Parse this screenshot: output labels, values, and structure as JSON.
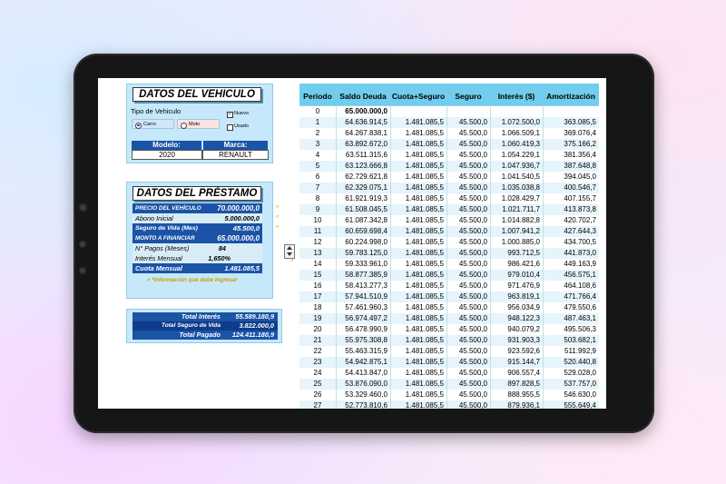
{
  "vehicle": {
    "title": "DATOS DEL VEHICULO",
    "type_label": "Tipo de Vehiculo",
    "options": [
      {
        "label": "Carro",
        "selected": true
      },
      {
        "label": "Moto",
        "selected": false
      }
    ],
    "condition": [
      {
        "label": "Nuevo",
        "checked": true
      },
      {
        "label": "Usado",
        "checked": false
      }
    ],
    "model_header": "Modelo:",
    "brand_header": "Marca:",
    "model_value": "2020",
    "brand_value": "RENAULT"
  },
  "loan": {
    "title": "DATOS DEL PRÉSTAMO",
    "rows": [
      {
        "label": "PRECIO DEL VEHÍCULO",
        "value": "70.000.000,0"
      },
      {
        "label": "Abono Inicial",
        "value": "5.000.000,0"
      },
      {
        "label": "Seguro de Vida (Mes)",
        "value": "45.500,0"
      },
      {
        "label": "MONTO A FINANCIAR",
        "value": "65.000.000,0"
      },
      {
        "label": "N° Pagos (Meses)",
        "value": "84"
      },
      {
        "label": "Interés Mensual",
        "value": "1,650%"
      },
      {
        "label": "Cuota Mensual",
        "value": "1.481.085,5"
      }
    ],
    "note": "« *Información que debe Ingresar"
  },
  "totals": {
    "rows": [
      {
        "label": "Total Interés",
        "value": "55.589.180,9"
      },
      {
        "label": "Total Seguro de Vida",
        "value": "3.822.000,0"
      },
      {
        "label": "Total Pagado",
        "value": "124.411.180,9"
      }
    ]
  },
  "table": {
    "headers": [
      "Periodo",
      "Saldo Deuda",
      "Cuota+Seguro",
      "Seguro",
      "Interés ($)",
      "Amortización"
    ],
    "rows": [
      [
        "0",
        "65.000.000,0",
        "",
        "",
        "",
        ""
      ],
      [
        "1",
        "64.636.914,5",
        "1.481.085,5",
        "45.500,0",
        "1.072.500,0",
        "363.085,5"
      ],
      [
        "2",
        "64.267.838,1",
        "1.481.085,5",
        "45.500,0",
        "1.066.509,1",
        "369.076,4"
      ],
      [
        "3",
        "63.892.672,0",
        "1.481.085,5",
        "45.500,0",
        "1.060.419,3",
        "375.166,2"
      ],
      [
        "4",
        "63.511.315,6",
        "1.481.085,5",
        "45.500,0",
        "1.054.229,1",
        "381.356,4"
      ],
      [
        "5",
        "63.123.666,8",
        "1.481.085,5",
        "45.500,0",
        "1.047.936,7",
        "387.648,8"
      ],
      [
        "6",
        "62.729.621,8",
        "1.481.085,5",
        "45.500,0",
        "1.041.540,5",
        "394.045,0"
      ],
      [
        "7",
        "62.329.075,1",
        "1.481.085,5",
        "45.500,0",
        "1.035.038,8",
        "400.546,7"
      ],
      [
        "8",
        "61.921.919,3",
        "1.481.085,5",
        "45.500,0",
        "1.028.429,7",
        "407.155,7"
      ],
      [
        "9",
        "61.508.045,5",
        "1.481.085,5",
        "45.500,0",
        "1.021.711,7",
        "413.873,8"
      ],
      [
        "10",
        "61.087.342,8",
        "1.481.085,5",
        "45.500,0",
        "1.014.882,8",
        "420.702,7"
      ],
      [
        "11",
        "60.659.698,4",
        "1.481.085,5",
        "45.500,0",
        "1.007.941,2",
        "427.644,3"
      ],
      [
        "12",
        "60.224.998,0",
        "1.481.085,5",
        "45.500,0",
        "1.000.885,0",
        "434.700,5"
      ],
      [
        "13",
        "59.783.125,0",
        "1.481.085,5",
        "45.500,0",
        "993.712,5",
        "441.873,0"
      ],
      [
        "14",
        "59.333.961,0",
        "1.481.085,5",
        "45.500,0",
        "986.421,6",
        "449.163,9"
      ],
      [
        "15",
        "58.877.385,9",
        "1.481.085,5",
        "45.500,0",
        "979.010,4",
        "456.575,1"
      ],
      [
        "16",
        "58.413.277,3",
        "1.481.085,5",
        "45.500,0",
        "971.476,9",
        "464.108,6"
      ],
      [
        "17",
        "57.941.510,9",
        "1.481.085,5",
        "45.500,0",
        "963.819,1",
        "471.766,4"
      ],
      [
        "18",
        "57.461.960,3",
        "1.481.085,5",
        "45.500,0",
        "956.034,9",
        "479.550,6"
      ],
      [
        "19",
        "56.974.497,2",
        "1.481.085,5",
        "45.500,0",
        "948.122,3",
        "487.463,1"
      ],
      [
        "20",
        "56.478.990,9",
        "1.481.085,5",
        "45.500,0",
        "940.079,2",
        "495.506,3"
      ],
      [
        "21",
        "55.975.308,8",
        "1.481.085,5",
        "45.500,0",
        "931.903,3",
        "503.682,1"
      ],
      [
        "22",
        "55.463.315,9",
        "1.481.085,5",
        "45.500,0",
        "923.592,6",
        "511.992,9"
      ],
      [
        "23",
        "54.942.875,1",
        "1.481.085,5",
        "45.500,0",
        "915.144,7",
        "520.440,8"
      ],
      [
        "24",
        "54.413.847,0",
        "1.481.085,5",
        "45.500,0",
        "906.557,4",
        "529.028,0"
      ],
      [
        "25",
        "53.876.090,0",
        "1.481.085,5",
        "45.500,0",
        "897.828,5",
        "537.757,0"
      ],
      [
        "26",
        "53.329.460,0",
        "1.481.085,5",
        "45.500,0",
        "888.955,5",
        "546.630,0"
      ],
      [
        "27",
        "52.773.810,6",
        "1.481.085,5",
        "45.500,0",
        "879.936,1",
        "555.649,4"
      ]
    ]
  },
  "colors": {
    "header_blue": "#70cdee",
    "dark_blue": "#1b53a6",
    "panel": "#c5e9fb"
  }
}
